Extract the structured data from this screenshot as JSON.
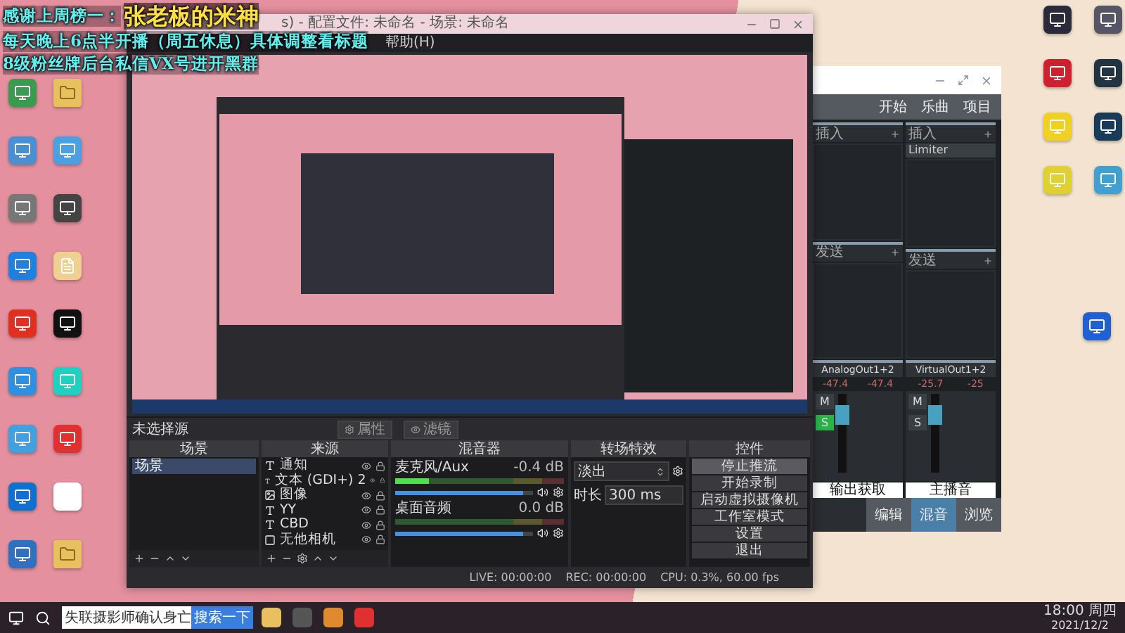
{
  "overlay": [
    {
      "text": "感谢上周榜一：",
      "highlight": "张老板的米神"
    },
    {
      "text": "每天晚上6点半开播（周五休息）具体调整看标题"
    },
    {
      "text": "8级粉丝牌后台私信VX号进开黑群"
    }
  ],
  "desktop_left": [
    {
      "kind": "app",
      "color": "#3a9a50"
    },
    {
      "kind": "folder",
      "color": "#e8c060"
    },
    {
      "kind": "app",
      "color": "#4a90d0"
    },
    {
      "kind": "app",
      "color": "#4aa0e0"
    },
    {
      "kind": "app",
      "color": "#777777"
    },
    {
      "kind": "app",
      "color": "#444444"
    },
    {
      "kind": "app",
      "color": "#2080e0"
    },
    {
      "kind": "doc",
      "color": "#f0d090"
    },
    {
      "kind": "app",
      "color": "#e03020"
    },
    {
      "kind": "app",
      "color": "#111111"
    },
    {
      "kind": "app",
      "color": "#3090e0"
    },
    {
      "kind": "app",
      "color": "#20d0c0"
    },
    {
      "kind": "app",
      "color": "#40a0e0"
    },
    {
      "kind": "app",
      "color": "#e03030"
    },
    {
      "kind": "app",
      "color": "#1070d0"
    },
    {
      "kind": "doc",
      "color": "#ffffff"
    },
    {
      "kind": "app",
      "color": "#3070c0"
    },
    {
      "kind": "folder",
      "color": "#e8c060"
    }
  ],
  "desktop_right": [
    {
      "kind": "app",
      "color": "#2a2a3a"
    },
    {
      "kind": "app",
      "color": "#555566"
    },
    {
      "kind": "app",
      "color": "#d02030"
    },
    {
      "kind": "app",
      "color": "#223344"
    },
    {
      "kind": "app",
      "color": "#f0d020"
    },
    {
      "kind": "app",
      "color": "#1a3a5a"
    },
    {
      "kind": "app",
      "color": "#e0d030"
    },
    {
      "kind": "app",
      "color": "#40a0d0"
    },
    {
      "kind": "app",
      "color": "#2060d0"
    }
  ],
  "obs": {
    "title": "s) - 配置文件: 未命名 - 场景: 未命名",
    "menu": [
      "帮助(H)"
    ],
    "source_bar": {
      "label": "未选择源",
      "buttons": [
        "属性",
        "滤镜"
      ]
    },
    "scenes": {
      "title": "场景",
      "items": [
        {
          "label": "场景",
          "selected": true
        }
      ]
    },
    "sources": {
      "title": "来源",
      "items": [
        {
          "kind": "text",
          "label": "通知"
        },
        {
          "kind": "text",
          "label": "文本 (GDI+) 2"
        },
        {
          "kind": "image",
          "label": "图像"
        },
        {
          "kind": "text",
          "label": "YY"
        },
        {
          "kind": "text",
          "label": "CBD"
        },
        {
          "kind": "camera",
          "label": "无他相机"
        }
      ]
    },
    "mixer": {
      "title": "混音器",
      "channels": [
        {
          "name": "麦克风/Aux",
          "reading": "-0.4 dB",
          "meter": {
            "level": 0.2
          },
          "volume": {
            "level": 0.93
          }
        },
        {
          "name": "桌面音频",
          "reading": "0.0 dB",
          "meter": {
            "level": 0
          },
          "volume": {
            "level": 0.93
          }
        }
      ]
    },
    "transitions": {
      "title": "转场特效",
      "value": "淡出",
      "duration_label": "时长",
      "duration": "300 ms"
    },
    "controls": {
      "title": "控件",
      "buttons": [
        {
          "label": "停止推流",
          "active": true
        },
        {
          "label": "开始录制",
          "active": false
        },
        {
          "label": "启动虚拟摄像机",
          "active": false
        },
        {
          "label": "工作室模式",
          "active": false
        },
        {
          "label": "设置",
          "active": false
        },
        {
          "label": "退出",
          "active": false
        }
      ]
    },
    "status": {
      "live": "LIVE: 00:00:00",
      "rec": "REC: 00:00:00",
      "cpu": "CPU: 0.3%, 60.00 fps"
    }
  },
  "studio": {
    "toolbar": [
      "开始",
      "乐曲",
      "项目"
    ],
    "strips": [
      {
        "insert_label": "插入",
        "send_label": "发送",
        "name": "AnalogOut1+2",
        "readings": [
          "-47.4",
          "-47.4"
        ],
        "mute": "M",
        "solo_label": "S",
        "solo": true,
        "output": "输出获取"
      },
      {
        "insert_label": "插入",
        "inserts": [
          "Limiter"
        ],
        "send_label": "发送",
        "name": "VirtualOut1+2",
        "readings": [
          "-25.7",
          "-25"
        ],
        "mute": "M",
        "solo_label": "S",
        "solo": false,
        "output": "主播音"
      }
    ],
    "tabs": [
      {
        "label": "编辑",
        "selected": false
      },
      {
        "label": "混音",
        "selected": true
      },
      {
        "label": "浏览",
        "selected": false
      }
    ]
  },
  "taskbar": {
    "search": "失联摄影师确认身亡",
    "search_button": "搜索一下",
    "time": "18:00 周四",
    "date": "2021/12/2"
  }
}
